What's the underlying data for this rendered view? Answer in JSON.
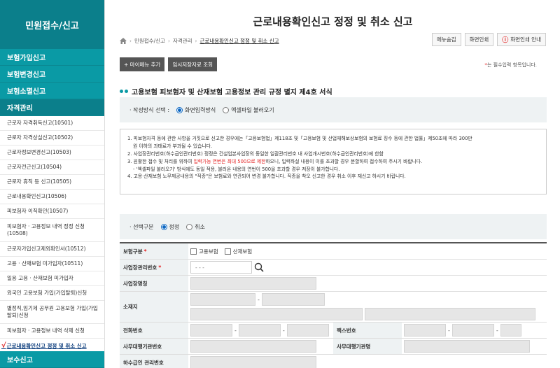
{
  "sidebar": {
    "header": "민원접수/신고",
    "categories_top": [
      "보험가입신고",
      "보험변경신고",
      "보험소멸신고"
    ],
    "active_category": "자격관리",
    "items": [
      "근로자 자격취득신고(10501)",
      "근로자 자격상실신고(10502)",
      "근로자정보변경신고(10503)",
      "근로자전근신고(10504)",
      "근로자 휴직 등 신고(10505)",
      "근로내용확인신고(10506)",
      "피보험자 이직확인(10507)",
      "피보험자 · 고용정보 내역 정정 신청(10508)",
      "근로자가입신고제외확인서(10512)",
      "고용 · 산재보험 미가입자(10511)",
      "일용 고용 · 산재보험 미가입자",
      "외국인 고용보험 가입(가입탈퇴)신청",
      "별정직,임기제 공무원 고용보험 가입(가입탈퇴)신청",
      "피보험자 · 고용정보 내역 삭제 신청"
    ],
    "current_item": "근로내용확인신고 정정 및 취소 신고",
    "bottom_category": "보수신고"
  },
  "main": {
    "title": "근로내용확인신고 정정 및 취소 신고",
    "breadcrumb": [
      "민원접수/신고",
      "자격관리",
      "근로내용확인신고 정정 및 취소 신고"
    ],
    "top_buttons": {
      "hide_menu": "메뉴숨김",
      "print": "화면인쇄",
      "print_guide": "화면인쇄 안내"
    },
    "actions": {
      "add_my_menu": "+ 마이메뉴 추가",
      "temp_lookup": "임시저장자료 조회"
    },
    "required_note": "는 필수입력 항목입니다.",
    "section_title": "고용보험 피보험자 및 산재보험 고용정보 관리 규정 별지 제4호 서식",
    "method": {
      "label": "· 작성방식 선택 :",
      "opt1": "화면입력방식",
      "opt2": "엑셀파일 불러오기"
    },
    "notice": {
      "l1": "1. 피보험자격 등에 관한 사항을 거짓으로 신고한 경우에는「고용보험법」제118조 및「고용보험 및 산업재해보상보험의 보험료 징수 등에 관한 법률」제50조에 따라 300만",
      "l1b": "원 이하의 과태료가 부과될 수 있습니다.",
      "l2": "2. 사업장관리번호(하수급인관리번호) 정정은 건설업본사업장의 동일한 일괄관리번호 내 사업개시번호(하수급인관리번호)에 한함",
      "l3a": "3. 원활한 접수 및 처리를 위하여 ",
      "l3red": "입력가능 연번은 최대 500으로 제한",
      "l3b": "하오니, 입력하실 내용이 이를 초과할 경우 분할하여 접수하여 주시기 바랍니다.",
      "l3c": "- '엑셀파일 불러오기' 방식에도 동일 적용, 불러온 내용의 연번이 500을 초과할 경우 저장이 불가합니다.",
      "l4": "4. 고용·산재보험 노무제공내용의 \"직종\"은 보험료와 연관되어 변경 불가합니다. 직종을 착오 신고한 경우 취소 이후 재신고 하시기 바랍니다."
    },
    "select": {
      "label": "· 선택구분",
      "opt1": "정정",
      "opt2": "취소"
    },
    "form": {
      "insurance_type": "보험구분",
      "employment": "고용보험",
      "accident": "산재보험",
      "biz_no": "사업장관리번호",
      "biz_no_placeholder": "- -  -",
      "biz_name": "사업장명칭",
      "address": "소재지",
      "phone": "전화번호",
      "fax": "팩스번호",
      "agency_no": "사무대행기관번호",
      "agency_name": "사무대행기관명",
      "sub_no": "하수급인 관리번호"
    }
  }
}
